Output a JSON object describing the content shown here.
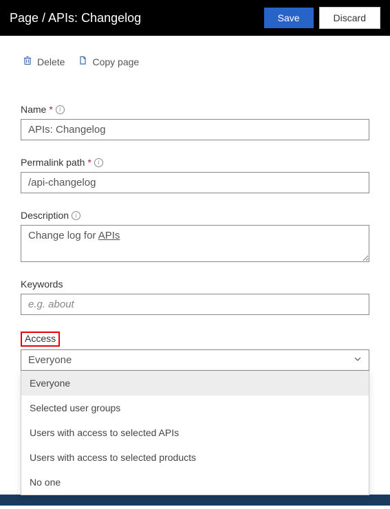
{
  "header": {
    "title": "Page / APIs: Changelog",
    "save_label": "Save",
    "discard_label": "Discard"
  },
  "toolbar": {
    "delete_label": "Delete",
    "copy_label": "Copy page"
  },
  "fields": {
    "name": {
      "label": "Name",
      "required_marker": "*",
      "value": "APIs: Changelog"
    },
    "permalink": {
      "label": "Permalink path",
      "required_marker": "*",
      "value": "/api-changelog"
    },
    "description": {
      "label": "Description",
      "value_prefix": "Change log for ",
      "value_underlined": "APIs"
    },
    "keywords": {
      "label": "Keywords",
      "placeholder": "e.g. about",
      "value": ""
    },
    "access": {
      "label": "Access",
      "selected": "Everyone",
      "options": [
        "Everyone",
        "Selected user groups",
        "Users with access to selected APIs",
        "Users with access to selected products",
        "No one"
      ]
    }
  }
}
